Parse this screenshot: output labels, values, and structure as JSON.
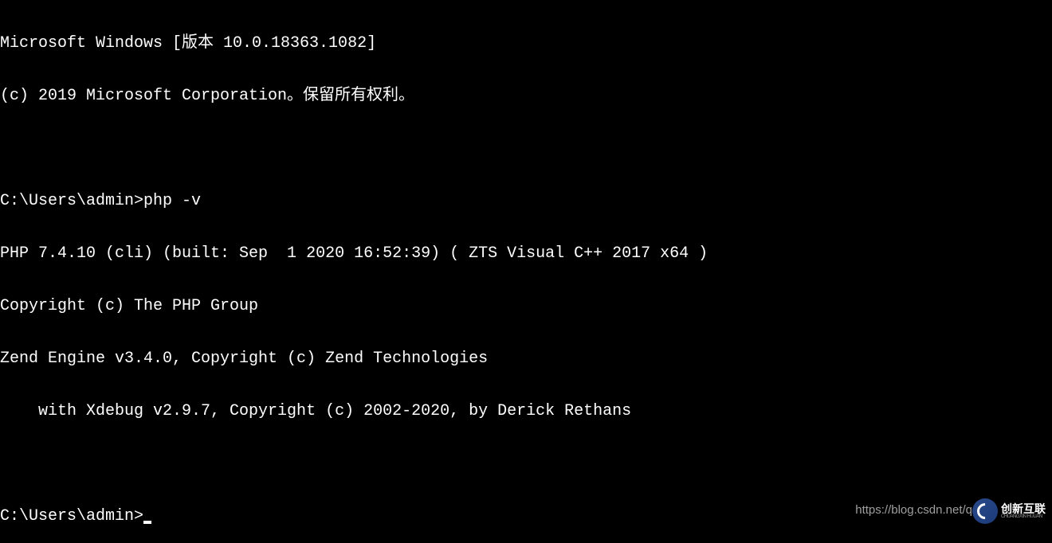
{
  "terminal": {
    "lines": [
      "Microsoft Windows [版本 10.0.18363.1082]",
      "(c) 2019 Microsoft Corporation。保留所有权利。",
      "",
      "C:\\Users\\admin>php -v",
      "PHP 7.4.10 (cli) (built: Sep  1 2020 16:52:39) ( ZTS Visual C++ 2017 x64 )",
      "Copyright (c) The PHP Group",
      "Zend Engine v3.4.0, Copyright (c) Zend Technologies",
      "    with Xdebug v2.9.7, Copyright (c) 2002-2020, by Derick Rethans",
      ""
    ],
    "prompt": "C:\\Users\\admin>"
  },
  "watermark": {
    "url": "https://blog.csdn.net/q",
    "logo_main": "创新互联",
    "logo_sub": "CHUANGXIN HULIAN"
  }
}
